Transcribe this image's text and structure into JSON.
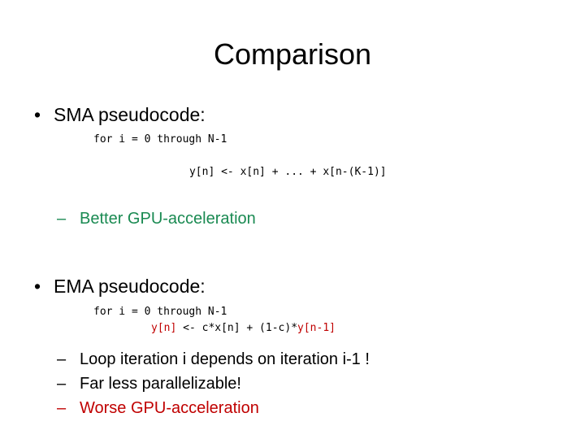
{
  "slide": {
    "title": "Comparison",
    "colors": {
      "text": "#000000",
      "green": "#1a8a52",
      "red": "#c00000",
      "background": "#ffffff"
    },
    "bullet_marker": "•",
    "dash_marker": "–",
    "blocks": [
      {
        "heading": "SMA pseudocode:",
        "code": {
          "line1": "for i = 0 through N-1",
          "line2_parts": [
            {
              "text": "y[n] <- x[n] + ... + x[n-(K-1)]",
              "color": "black"
            }
          ]
        },
        "sub_bullets": [
          {
            "text": "Better GPU-acceleration",
            "color": "green"
          }
        ]
      },
      {
        "heading": "EMA pseudocode:",
        "code": {
          "line1": "for i = 0 through N-1",
          "line2_parts": [
            {
              "text": "y[n]",
              "color": "red"
            },
            {
              "text": " <- c*x[n] + (1-c)*",
              "color": "black"
            },
            {
              "text": "y[n-1]",
              "color": "red"
            }
          ]
        },
        "sub_bullets": [
          {
            "text": "Loop iteration i depends on iteration i-1 !",
            "color": "black"
          },
          {
            "text": "Far less parallelizable!",
            "color": "black"
          },
          {
            "text": "Worse GPU-acceleration",
            "color": "red"
          }
        ]
      }
    ]
  }
}
